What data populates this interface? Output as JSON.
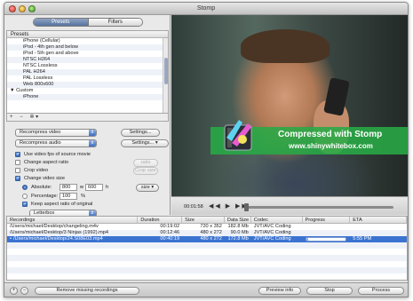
{
  "window": {
    "title": "Stomp"
  },
  "segmented": {
    "presets": "Presets",
    "filters": "Filters"
  },
  "presets": {
    "header": "Presets",
    "items": [
      {
        "label": "iPhone (Cellular)"
      },
      {
        "label": "iPod - 4th gen and below"
      },
      {
        "label": "iPod - 5th gen and above"
      },
      {
        "label": "NTSC H264"
      },
      {
        "label": "NTSC Lossless"
      },
      {
        "label": "PAL H264"
      },
      {
        "label": "PAL Lossless"
      },
      {
        "label": "Web 800x600"
      },
      {
        "label": "Custom",
        "group": true
      },
      {
        "label": "iPhone"
      }
    ],
    "tools": {
      "add": "+",
      "remove": "−",
      "action": "✲ ▾"
    }
  },
  "settings": {
    "video_mode": "Recompress video",
    "audio_mode": "Recompress audio",
    "video_settings_button": "Settings...",
    "audio_settings_button": "Settings...",
    "use_fps": "Use video fps of source movie",
    "change_aspect": "Change aspect ratio",
    "crop_video": "Crop video",
    "change_size": "Change video size",
    "ratio_button": "ratio",
    "crop_size_button": "Crop size",
    "size_button": "size",
    "absolute_label": "Absolute:",
    "width": "800",
    "times": "w",
    "height": "600",
    "height_unit": "h",
    "percentage_label": "Percentage:",
    "percentage_value": "100",
    "percent_sign": "%",
    "keep_aspect": "Keep aspect ratio of original",
    "letterbox": "Letterbox",
    "use_fps_checked": true,
    "change_aspect_checked": false,
    "crop_video_checked": false,
    "change_size_checked": true,
    "keep_aspect_checked": true
  },
  "video": {
    "banner_line1": "Compressed with Stomp",
    "banner_line2": "www.shinywhitebox.com",
    "timecode": "00:01:58",
    "transport": "◀◀ ▶ ▶▶",
    "position_fraction": 0.0
  },
  "table": {
    "headers": [
      "Recordings",
      "Duration",
      "Size",
      "Data Size",
      "Codec",
      "Progress",
      "ETA"
    ],
    "rows": [
      {
        "path": "/Users/michael/Desktop/changeling.m4v",
        "duration": "00:19:02",
        "size": "720 x 352",
        "data_size": "182.8 Mb",
        "codec": "JVT/AVC Coding",
        "progress": "",
        "eta": ""
      },
      {
        "path": "/Users/michael/Desktop/3 Ninjas (1992).mp4",
        "duration": "00:12:46",
        "size": "480 x 272",
        "data_size": "90.0 Mb",
        "codec": "JVT/AVC Coding",
        "progress": "",
        "eta": ""
      },
      {
        "path": "/Users/michael/Desktop/24.S08E03.mp4",
        "duration": "00:40:19",
        "size": "480 x 272",
        "data_size": "172.8 Mb",
        "codec": "JVT/AVC Coding",
        "progress": 0.05,
        "eta": "5:55 PM",
        "selected": true,
        "marker": "•"
      }
    ]
  },
  "bottom": {
    "add": "+",
    "remove": "−",
    "remove_missing": "Remove missing recordings",
    "preview_info": "Preview info",
    "stop": "Stop",
    "process": "Process"
  }
}
